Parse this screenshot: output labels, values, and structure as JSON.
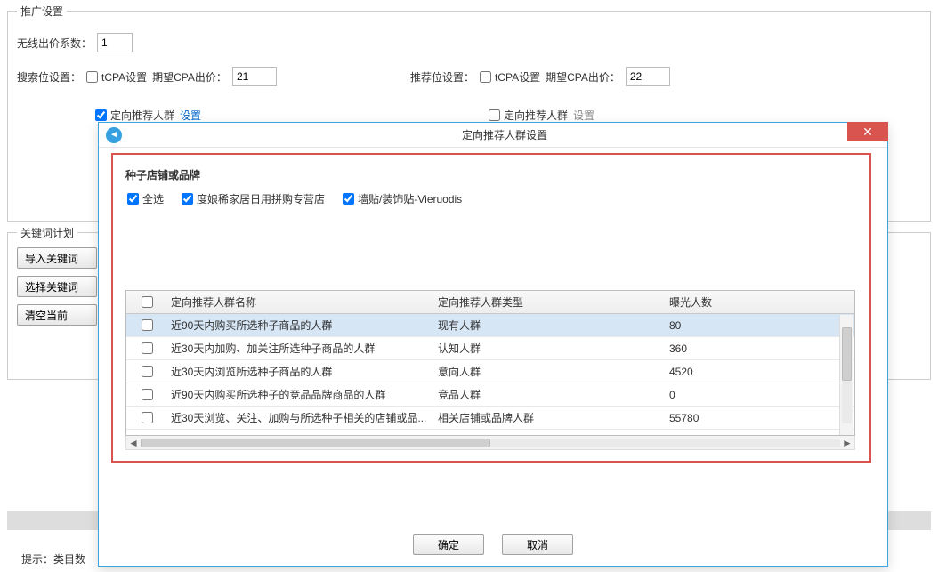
{
  "promo": {
    "legend": "推广设置",
    "wireless_bid_label": "无线出价系数：",
    "wireless_bid_value": "1",
    "search_pos_label": "搜索位设置：",
    "rec_pos_label": "推荐位设置：",
    "tcpa_label": "tCPA设置",
    "expected_cpa_label": "期望CPA出价：",
    "search_cpa_value": "21",
    "rec_cpa_value": "22",
    "targeted_label": "定向推荐人群",
    "set_link": "设置"
  },
  "keyword": {
    "legend": "关键词计划",
    "import_btn": "导入关键词",
    "select_btn": "选择关键词",
    "clear_btn": "清空当前"
  },
  "hint": "提示：类目数",
  "modal": {
    "title": "定向推荐人群设置",
    "seed_section_title": "种子店铺或品牌",
    "select_all": "全选",
    "seed_items": [
      {
        "label": "度娘稀家居日用拼购专营店"
      },
      {
        "label": "墙贴/装饰贴-Vieruodis"
      }
    ],
    "columns": {
      "name": "定向推荐人群名称",
      "type": "定向推荐人群类型",
      "exposure": "曝光人数"
    },
    "rows": [
      {
        "name": "近90天内购买所选种子商品的人群",
        "type": "现有人群",
        "exposure": "80"
      },
      {
        "name": "近30天内加购、加关注所选种子商品的人群",
        "type": "认知人群",
        "exposure": "360"
      },
      {
        "name": "近30天内浏览所选种子商品的人群",
        "type": "意向人群",
        "exposure": "4520"
      },
      {
        "name": "近90天内购买所选种子的竞品品牌商品的人群",
        "type": "竞品人群",
        "exposure": "0"
      },
      {
        "name": "近30天浏览、关注、加购与所选种子相关的店铺或品...",
        "type": "相关店铺或品牌人群",
        "exposure": "55780"
      }
    ],
    "ok": "确定",
    "cancel": "取消"
  }
}
